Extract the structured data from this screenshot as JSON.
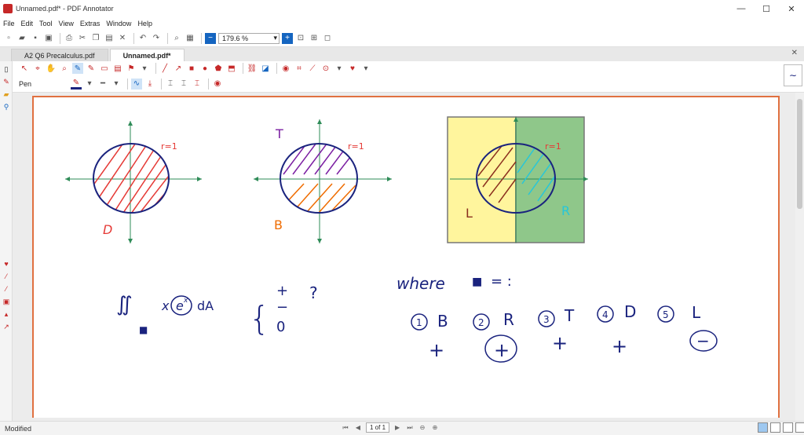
{
  "window": {
    "title": "Unnamed.pdf* - PDF Annotator",
    "minimize": "—",
    "maximize": "☐",
    "close": "✕"
  },
  "menu": [
    "File",
    "Edit",
    "Tool",
    "View",
    "Extras",
    "Window",
    "Help"
  ],
  "toolbar": {
    "zoom_value": "179.6 %"
  },
  "tabs": [
    {
      "label": "A2 Q6 Precalculus.pdf"
    },
    {
      "label": "Unnamed.pdf*"
    }
  ],
  "tab_close": "✕",
  "pen": {
    "label": "Pen",
    "color": "#1a237e"
  },
  "colors": {
    "accent": "#e07040",
    "red": "#e53935",
    "blue": "#1a237e",
    "yellow": "#fff59d",
    "green": "#8fc78a",
    "cyan": "#26c6da",
    "orange": "#ef6c00",
    "purple": "#7b1fa2",
    "axis_green": "#2e8b57"
  },
  "canvas": {
    "d1": {
      "label_r": "r=1",
      "label_region": "D"
    },
    "d2": {
      "label_top": "T",
      "label_r": "r=1",
      "label_bottom": "B"
    },
    "d3": {
      "label_r": "r=1",
      "label_left": "L",
      "label_right": "R"
    },
    "integral": {
      "expr": "∬",
      "sub": "■",
      "integrand": "x",
      "exp": "e",
      "exp_power": "x",
      "da": "dA",
      "choices": [
        "+",
        "−",
        "0"
      ],
      "question": "?"
    },
    "where": {
      "text": "where",
      "box": "■",
      "eq": "= :"
    },
    "options": [
      {
        "num": "1",
        "region": "B",
        "sign": "+"
      },
      {
        "num": "2",
        "region": "R",
        "sign": "+"
      },
      {
        "num": "3",
        "region": "T",
        "sign": "+"
      },
      {
        "num": "4",
        "region": "D",
        "sign": "+"
      },
      {
        "num": "5",
        "region": "L",
        "sign": "−"
      }
    ]
  },
  "status": {
    "text": "Modified",
    "page": "1 of 1"
  }
}
